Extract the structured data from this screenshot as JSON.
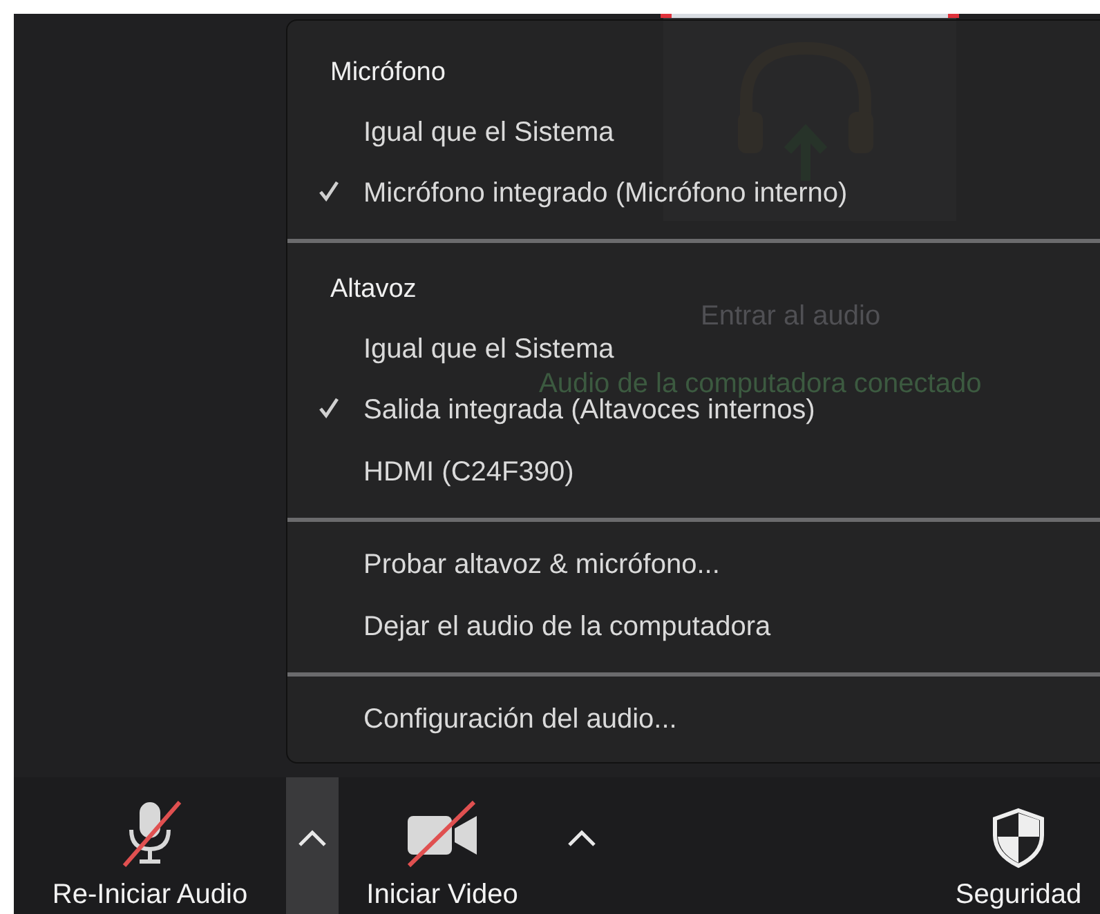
{
  "background_tile": {
    "title": "Entrar al audio",
    "status": "Audio de la computadora conectado"
  },
  "menu": {
    "sections": [
      {
        "header": "Micrófono",
        "items": [
          {
            "label": "Igual que el Sistema",
            "checked": false
          },
          {
            "label": "Micrófono integrado (Micrófono interno)",
            "checked": true
          }
        ]
      },
      {
        "header": "Altavoz",
        "items": [
          {
            "label": "Igual que el Sistema",
            "checked": false
          },
          {
            "label": "Salida integrada (Altavoces internos)",
            "checked": true
          },
          {
            "label": "HDMI (C24F390)",
            "checked": false
          }
        ]
      },
      {
        "items": [
          {
            "label": "Probar altavoz & micrófono...",
            "checked": false
          },
          {
            "label": "Dejar el audio de la computadora",
            "checked": false
          }
        ]
      },
      {
        "items": [
          {
            "label": "Configuración del audio...",
            "checked": false
          }
        ]
      }
    ]
  },
  "toolbar": [
    {
      "kind": "audio",
      "label": "Re-Iniciar Audio",
      "muted": true
    },
    {
      "kind": "caret",
      "expanded": true
    },
    {
      "kind": "video",
      "label": "Iniciar Video",
      "muted": true
    },
    {
      "kind": "caret",
      "expanded": false
    },
    {
      "kind": "spacer"
    },
    {
      "kind": "security",
      "label": "Seguridad"
    }
  ]
}
